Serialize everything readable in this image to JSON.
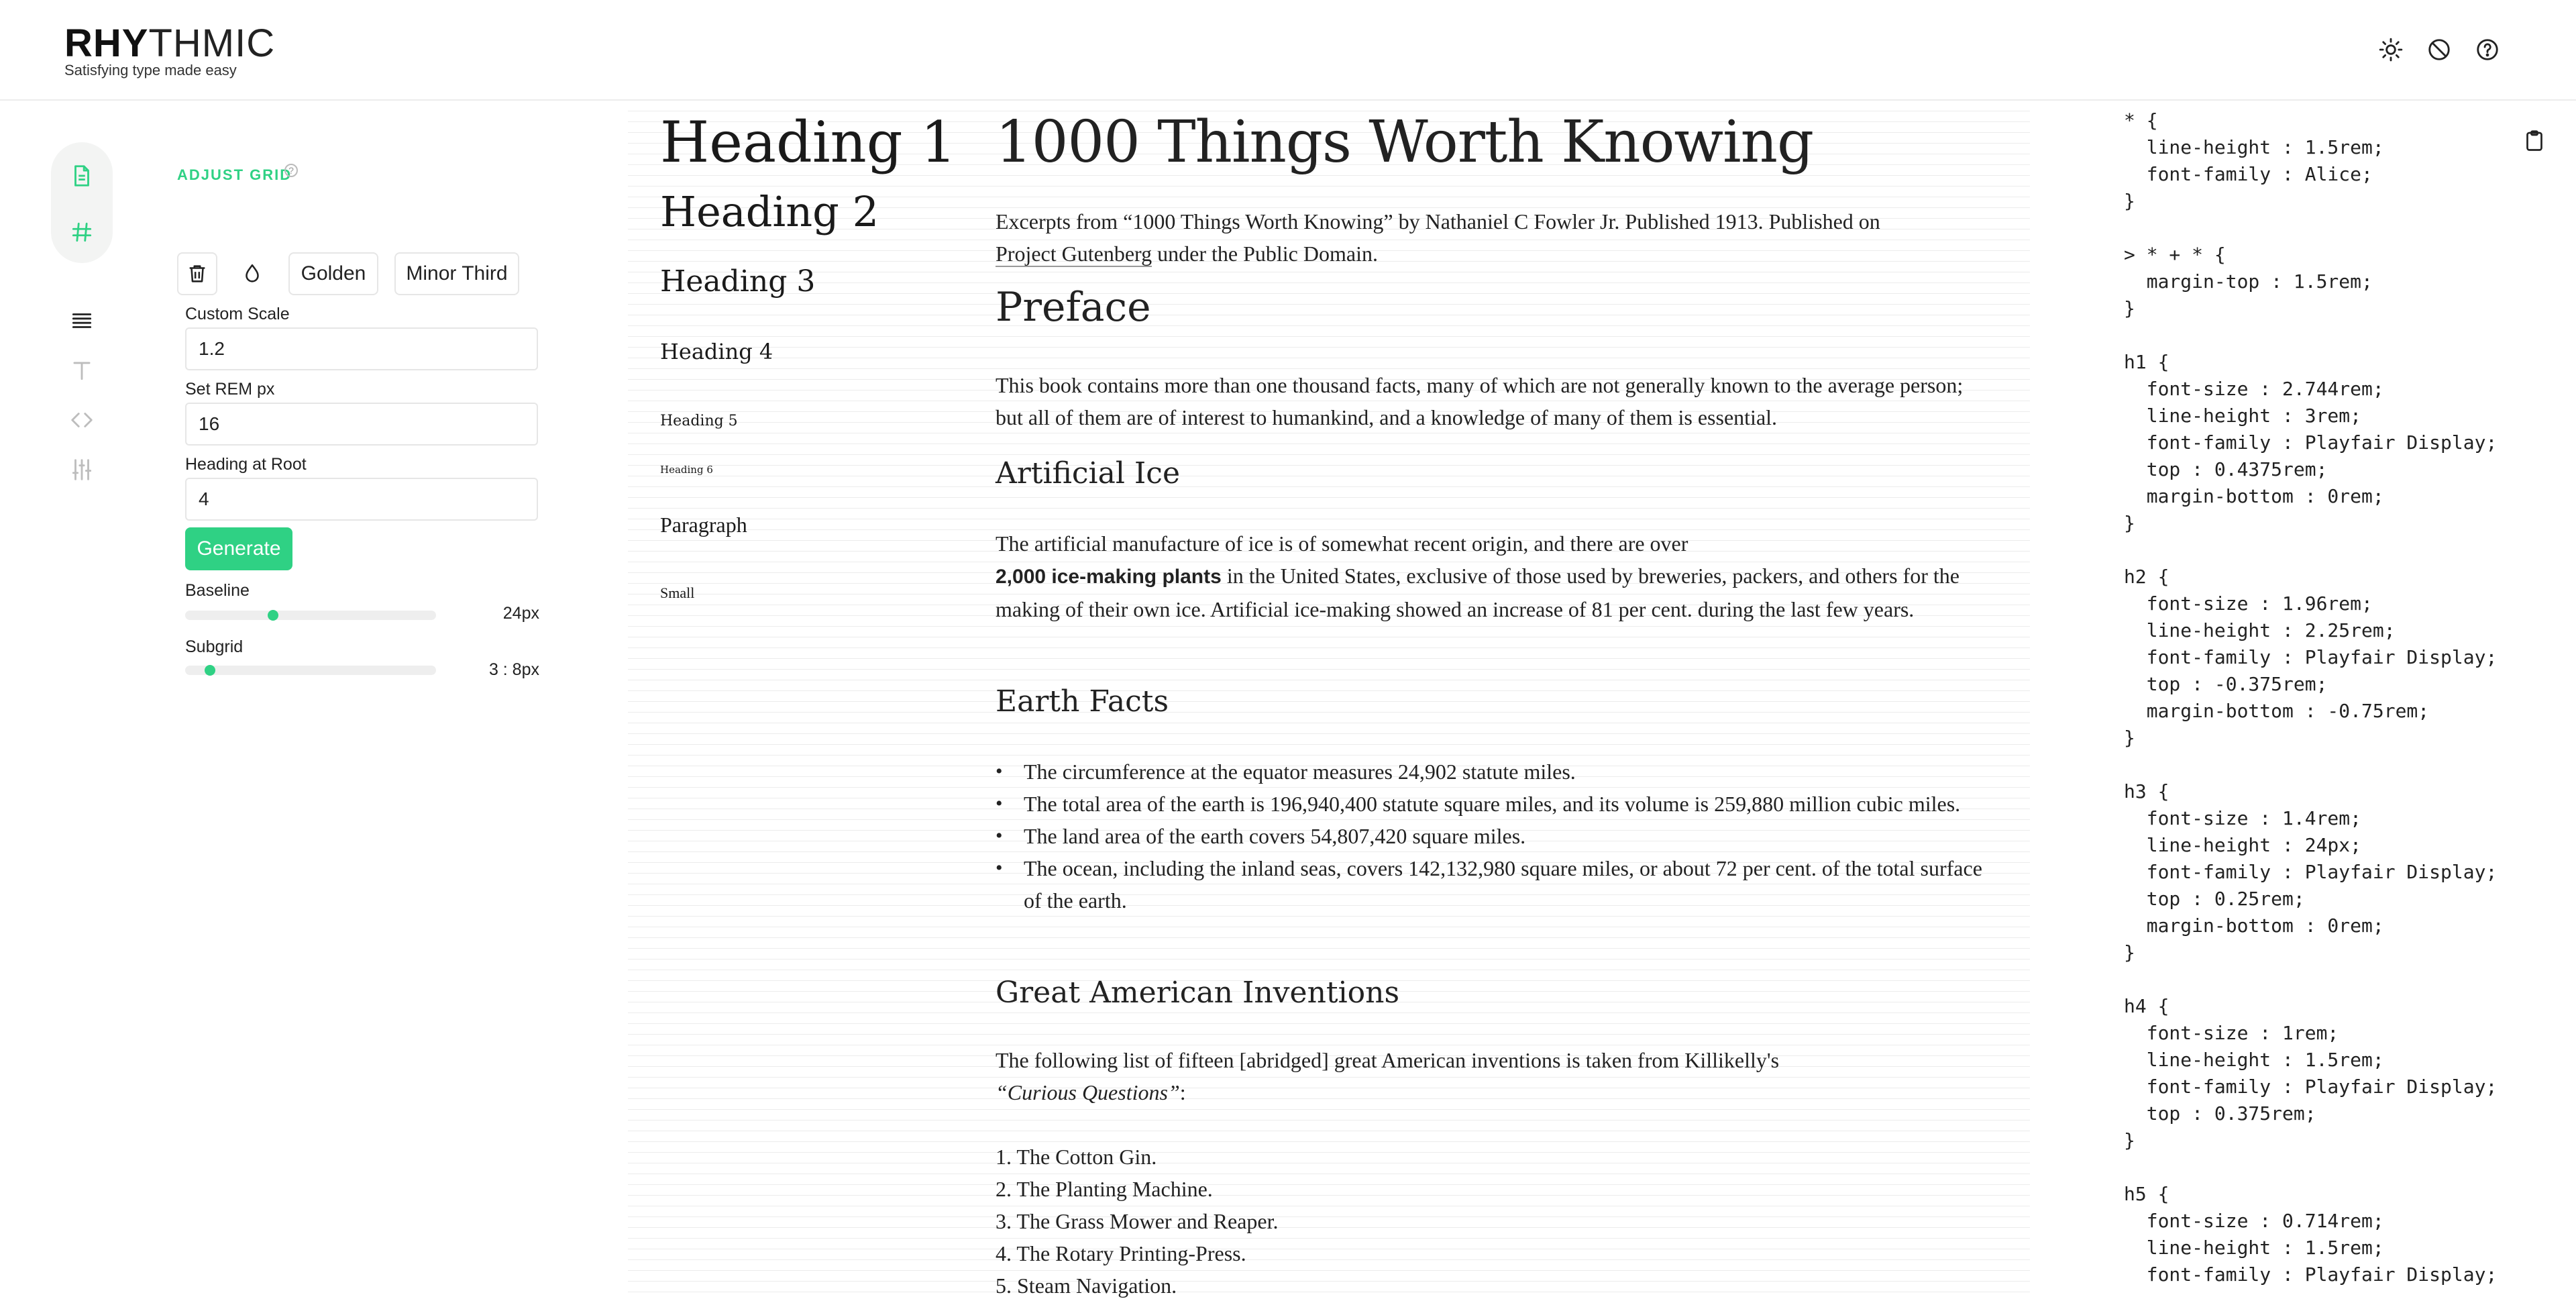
{
  "app": {
    "logo_bold": "RHY",
    "logo_rest": "THMIC",
    "tagline": "Satisfying type made easy"
  },
  "header_icons": [
    {
      "name": "theme-toggle-icon"
    },
    {
      "name": "block-icon"
    },
    {
      "name": "help-icon"
    }
  ],
  "rail": {
    "items": [
      "document-icon",
      "grid-icon",
      "lines-icon",
      "type-icon",
      "code-icon",
      "sliders-icon"
    ]
  },
  "controls": {
    "section_title": "ADJUST GRID",
    "info_glyph": "?",
    "preset_golden": "Golden",
    "preset_minor_third": "Minor Third",
    "custom_scale_label": "Custom Scale",
    "custom_scale_value": "1.2",
    "rem_label": "Set REM px",
    "rem_value": "16",
    "heading_root_label": "Heading at Root",
    "heading_root_value": "4",
    "generate_label": "Generate",
    "baseline_label": "Baseline",
    "baseline_value": "24px",
    "baseline_fraction": 0.35,
    "subgrid_label": "Subgrid",
    "subgrid_value": "3 : 8px",
    "subgrid_fraction": 0.1
  },
  "scale_preview": [
    "Heading 1",
    "Heading 2",
    "Heading 3",
    "Heading 4",
    "Heading 5",
    "Heading 6",
    "Paragraph",
    "Small"
  ],
  "document": {
    "title": "1000 Things Worth Knowing",
    "intro_a": "Excerpts from “1000 Things Worth Knowing” by Nathaniel C Fowler Jr. Published 1913. Published on",
    "intro_link": "Project Gutenberg",
    "intro_b": " under the Public Domain.",
    "preface_heading": "Preface",
    "preface_text": "This book contains more than one thousand facts, many of which are not generally known to the average person; but all of them are of interest to humankind, and a knowledge of many of them is essential.",
    "ice_heading": "Artificial Ice",
    "ice_line1": "The artificial manufacture of ice is of somewhat recent origin, and there are over",
    "ice_bold": "2,000 ice-making plants",
    "ice_rest": " in the United States, exclusive of those used by breweries, packers, and others for the making of their own ice. Artificial ice-making showed an increase of 81 per cent. during the last few years.",
    "earth_heading": "Earth Facts",
    "earth_facts": [
      "The circumference at the equator measures 24,902 statute miles.",
      "The total area of the earth is 196,940,400 statute square miles, and its volume is 259,880 million cubic miles.",
      "The land area of the earth covers 54,807,420 square miles.",
      "The ocean, including the inland seas, covers 142,132,980 square miles, or about 72 per cent. of the total surface of the earth."
    ],
    "inventions_heading": "Great American Inventions",
    "inventions_intro": "The following list of fifteen [abridged] great American inventions is taken from Killikelly's",
    "inventions_italic": "“Curious Questions”",
    "inventions_colon": ":",
    "inventions": [
      "1. The Cotton Gin.",
      "2. The Planting Machine.",
      "3. The Grass Mower and Reaper.",
      "4. The Rotary Printing-Press.",
      "5. Steam Navigation."
    ]
  },
  "code_lines": [
    "* {",
    "  line-height : 1.5rem;",
    "  font-family : Alice;",
    "}",
    "",
    "> * + * {",
    "  margin-top : 1.5rem;",
    "}",
    "",
    "h1 {",
    "  font-size : 2.744rem;",
    "  line-height : 3rem;",
    "  font-family : Playfair Display;",
    "  top : 0.4375rem;",
    "  margin-bottom : 0rem;",
    "}",
    "",
    "h2 {",
    "  font-size : 1.96rem;",
    "  line-height : 2.25rem;",
    "  font-family : Playfair Display;",
    "  top : -0.375rem;",
    "  margin-bottom : -0.75rem;",
    "}",
    "",
    "h3 {",
    "  font-size : 1.4rem;",
    "  line-height : 24px;",
    "  font-family : Playfair Display;",
    "  top : 0.25rem;",
    "  margin-bottom : 0rem;",
    "}",
    "",
    "h4 {",
    "  font-size : 1rem;",
    "  line-height : 1.5rem;",
    "  font-family : Playfair Display;",
    "  top : 0.375rem;",
    "}",
    "",
    "h5 {",
    "  font-size : 0.714rem;",
    "  line-height : 1.5rem;",
    "  font-family : Playfair Display;"
  ],
  "colors": {
    "accent": "#2fd184",
    "grid_line": "#ececec",
    "border": "#e6e6e6"
  }
}
